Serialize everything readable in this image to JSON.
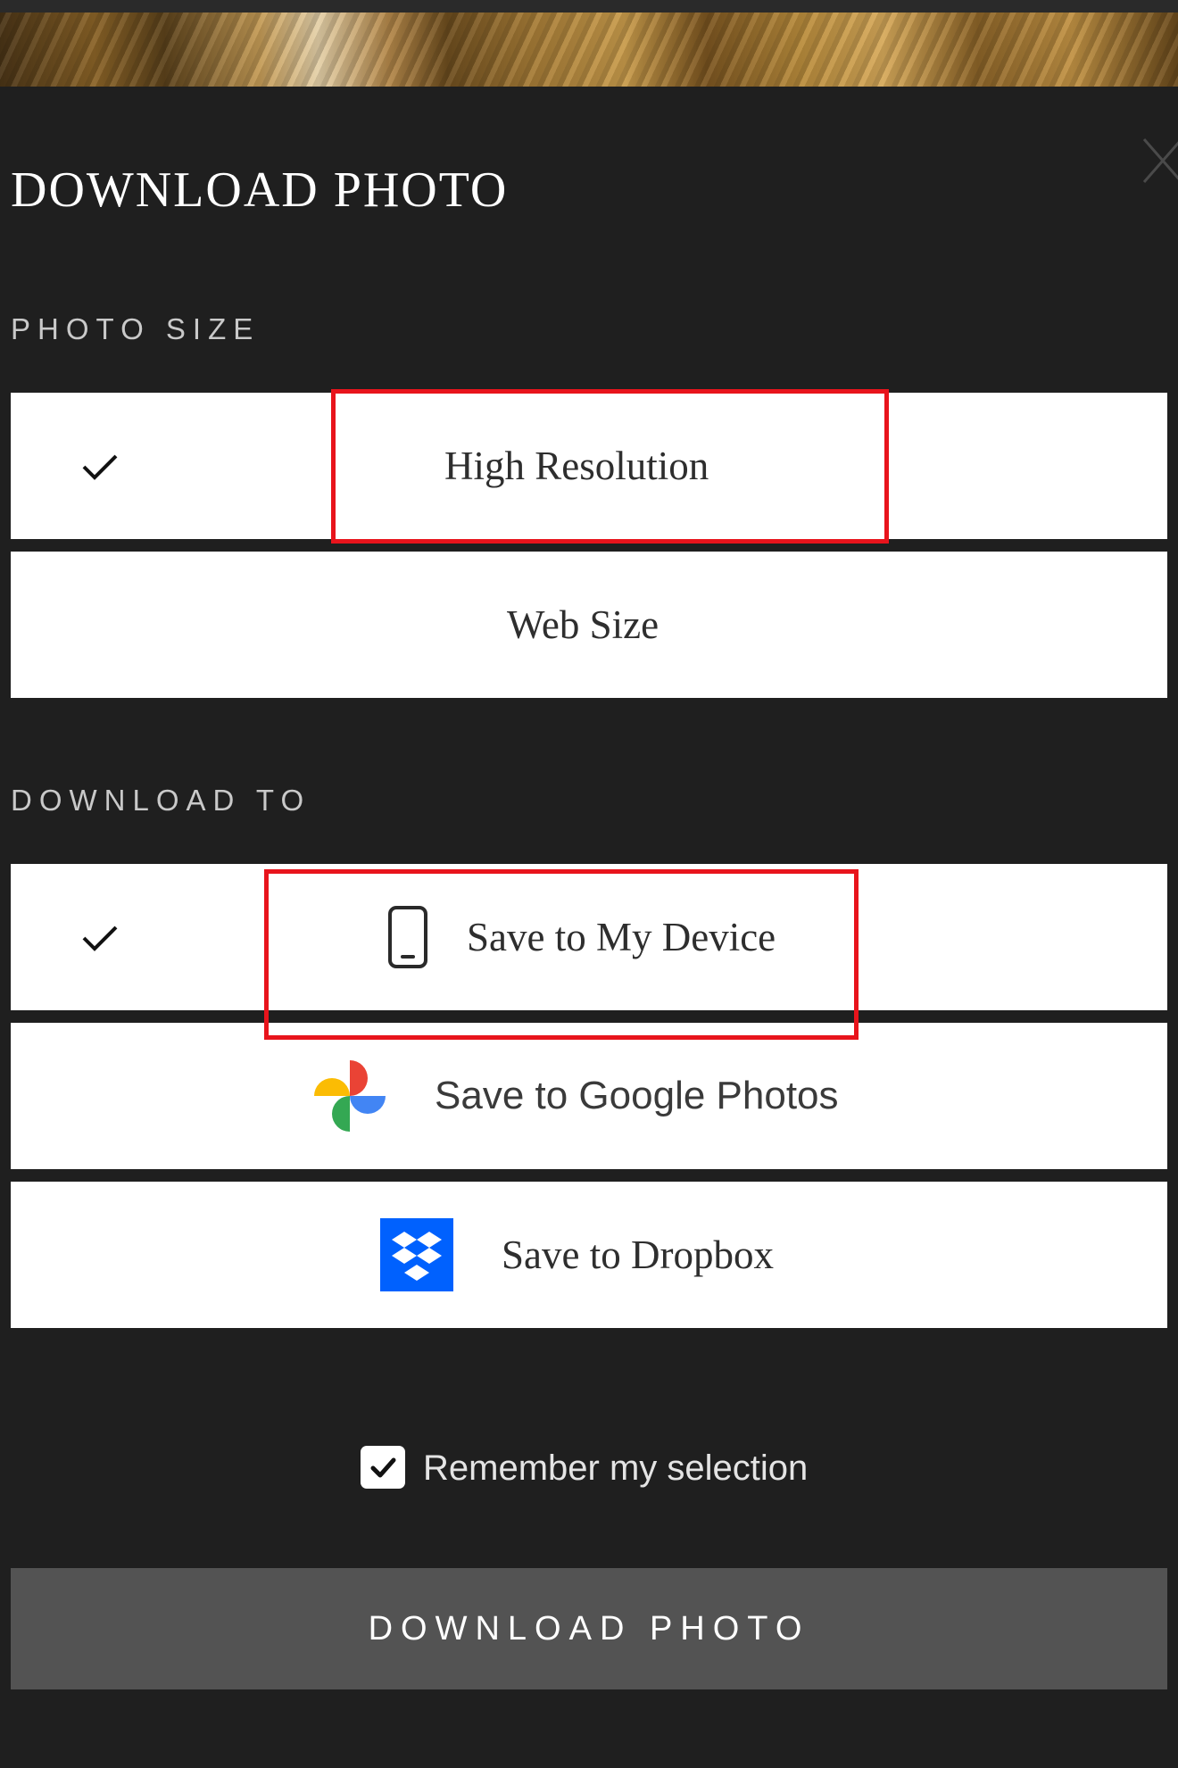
{
  "dialog": {
    "title": "DOWNLOAD PHOTO",
    "photo_size": {
      "label": "PHOTO SIZE",
      "options": [
        {
          "label": "High Resolution",
          "selected": true
        },
        {
          "label": "Web Size",
          "selected": false
        }
      ]
    },
    "download_to": {
      "label": "DOWNLOAD TO",
      "options": [
        {
          "label": "Save to My Device",
          "icon": "phone-icon",
          "selected": true
        },
        {
          "label": "Save to Google Photos",
          "icon": "google-photos-icon",
          "selected": false
        },
        {
          "label": "Save to Dropbox",
          "icon": "dropbox-icon",
          "selected": false
        }
      ]
    },
    "remember": {
      "label": "Remember my selection",
      "checked": true
    },
    "download_button": "DOWNLOAD PHOTO"
  },
  "colors": {
    "background": "#1f1f1f",
    "option_bg": "#ffffff",
    "button_bg": "#535353",
    "highlight": "#e8141c",
    "dropbox_blue": "#0061fe"
  }
}
